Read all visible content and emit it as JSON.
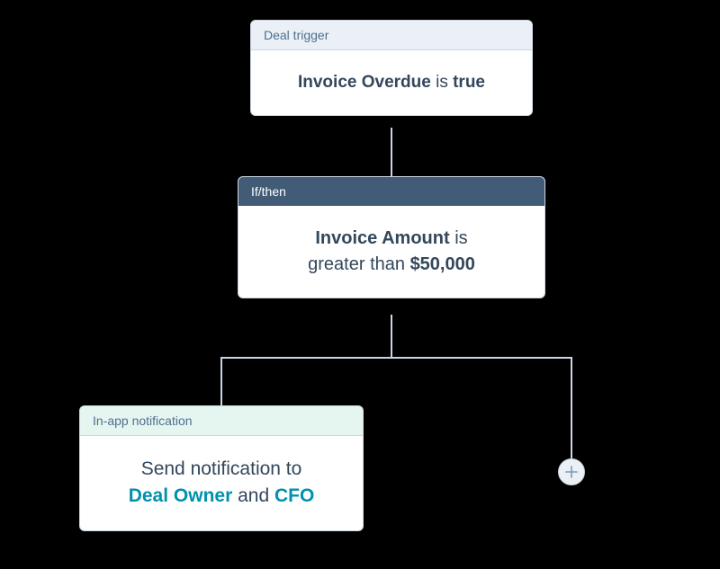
{
  "trigger": {
    "header": "Deal trigger",
    "field": "Invoice Overdue",
    "mid": " is ",
    "value": "true"
  },
  "condition": {
    "header": "If/then",
    "field": "Invoice Amount",
    "mid1": " is",
    "line2a": "greater than ",
    "value": "$50,000"
  },
  "action": {
    "header": "In-app notification",
    "line1": "Send notification to",
    "role1": "Deal Owner",
    "mid": " and ",
    "role2": "CFO"
  },
  "colors": {
    "teal": "#0091ae",
    "slate": "#33475b",
    "headerDark": "#425b76"
  }
}
